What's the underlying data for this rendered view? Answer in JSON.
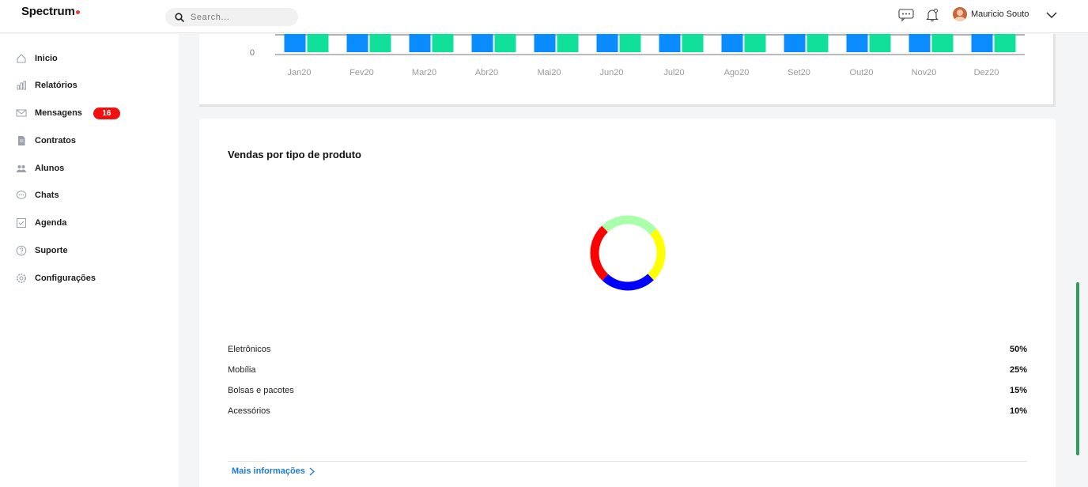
{
  "app": {
    "logo": "Spectrum",
    "accent": "#e83b3b"
  },
  "header": {
    "search_placeholder": "Search...",
    "icons": [
      "chat-icon",
      "bell-icon",
      "chevron-down-icon"
    ],
    "user_name": "Mauricio Souto"
  },
  "sidebar": {
    "items": [
      {
        "label": "Inicio",
        "icon": "home-icon"
      },
      {
        "label": "Relatórios",
        "icon": "chart-icon"
      },
      {
        "label": "Mensagens",
        "icon": "mail-icon",
        "badge": "16"
      },
      {
        "label": "Contratos",
        "icon": "document-icon"
      },
      {
        "label": "Alunos",
        "icon": "users-icon"
      },
      {
        "label": "Chats",
        "icon": "chat-bubble-icon"
      },
      {
        "label": "Agenda",
        "icon": "calendar-icon"
      },
      {
        "label": "Suporte",
        "icon": "help-icon"
      },
      {
        "label": "Configurações",
        "icon": "gear-icon"
      }
    ]
  },
  "chart_data": [
    {
      "type": "bar",
      "ytick_visible": [
        "0"
      ],
      "categories": [
        "Jan20",
        "Fev20",
        "Mar20",
        "Abr20",
        "Mai20",
        "Jun20",
        "Jul20",
        "Ago20",
        "Set20",
        "Out20",
        "Nov20",
        "Dez20"
      ],
      "series": [
        {
          "color": "#0a8cff"
        },
        {
          "color": "#10e09a"
        }
      ]
    },
    {
      "type": "pie",
      "title": "Vendas por tipo de produto",
      "labels": [
        "Eletrônicos",
        "Mobília",
        "Bolsas e pacotes",
        "Acessórios"
      ],
      "values": [
        50,
        25,
        15,
        10
      ],
      "display_values": [
        "50%",
        "25%",
        "15%",
        "10%"
      ],
      "ring": [
        {
          "color": "#ffff00",
          "share": 0.24
        },
        {
          "color": "#0000ff",
          "share": 0.24
        },
        {
          "color": "#ff0000",
          "share": 0.26
        },
        {
          "color": "#aaffaa",
          "share": 0.26
        }
      ]
    }
  ],
  "card": {
    "more_label": "Mais informações"
  }
}
